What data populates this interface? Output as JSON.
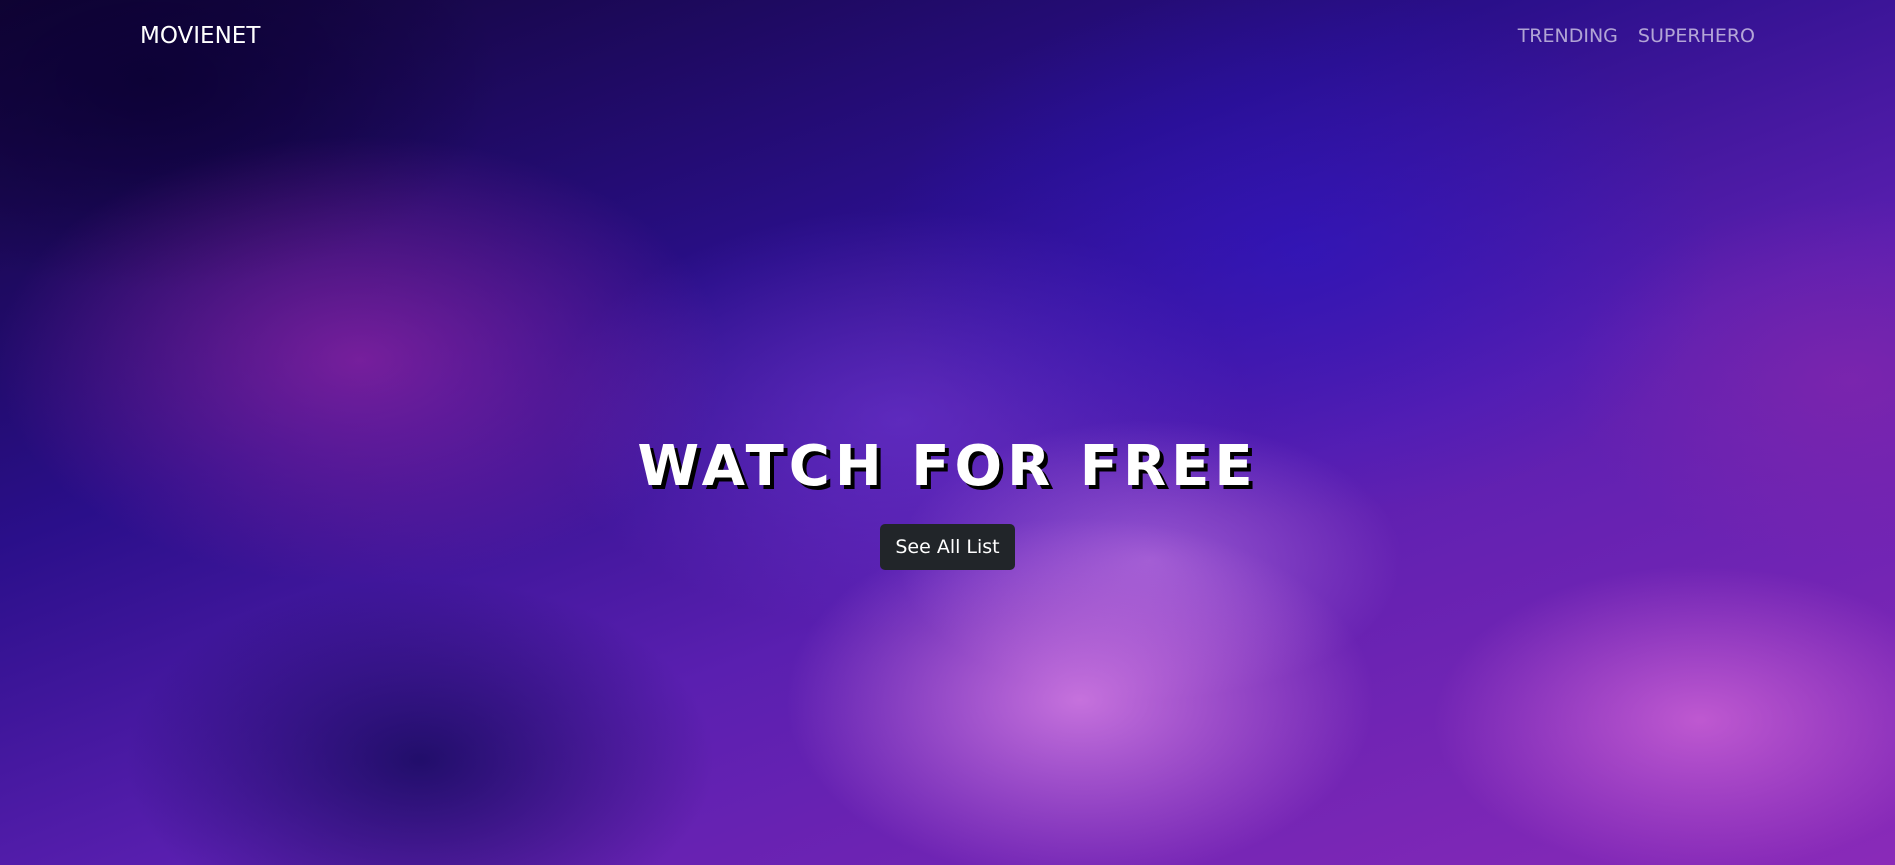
{
  "navbar": {
    "brand": "MOVIENET",
    "links": [
      "TRENDING",
      "SUPERHERO"
    ]
  },
  "hero": {
    "headline": "WATCH FOR FREE",
    "cta_label": "See All List"
  },
  "colors": {
    "button_bg": "#212529",
    "text": "#ffffff",
    "nav_link": "rgba(255,255,255,0.62)",
    "background_primary": "#2a0f8a",
    "background_accent": "#d07ae0"
  }
}
